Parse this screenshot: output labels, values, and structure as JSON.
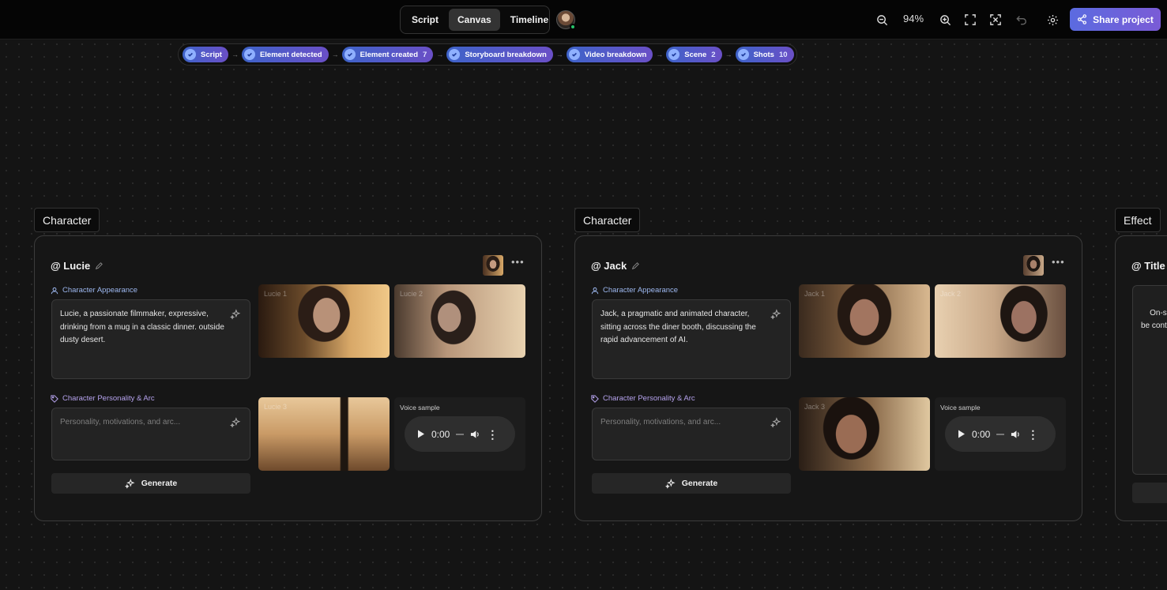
{
  "header": {
    "tabs": [
      {
        "label": "Script"
      },
      {
        "label": "Canvas"
      },
      {
        "label": "Timeline"
      }
    ],
    "zoom": "94%",
    "share_label": "Share project"
  },
  "pipeline": [
    {
      "label": "Script",
      "count": ""
    },
    {
      "label": "Element detected",
      "count": ""
    },
    {
      "label": "Element created",
      "count": "7"
    },
    {
      "label": "Storyboard breakdown",
      "count": ""
    },
    {
      "label": "Video breakdown",
      "count": ""
    },
    {
      "label": "Scene",
      "count": "2"
    },
    {
      "label": "Shots",
      "count": "10"
    }
  ],
  "cards": [
    {
      "type_label": "Character",
      "title": "@ Lucie",
      "appearance_label": "Character Appearance",
      "appearance_text": "Lucie, a passionate filmmaker, expressive, drinking from a mug in a classic dinner. outside dusty desert.",
      "personality_label": "Character Personality & Arc",
      "personality_placeholder": "Personality, motivations, and arc...",
      "generate_label": "Generate",
      "images": [
        "Lucie 1",
        "Lucie 2",
        "Lucie 3"
      ],
      "voice_label": "Voice sample",
      "voice_time": "0:00"
    },
    {
      "type_label": "Character",
      "title": "@ Jack",
      "appearance_label": "Character Appearance",
      "appearance_text": "Jack, a pragmatic and animated character, sitting across the diner booth, discussing the rapid advancement of AI.",
      "personality_label": "Character Personality & Arc",
      "personality_placeholder": "Personality, motivations, and arc...",
      "generate_label": "Generate",
      "images": [
        "Jack 1",
        "Jack 2",
        "Jack 3"
      ],
      "voice_label": "Voice sample",
      "voice_time": "0:00"
    },
    {
      "type_label": "Effect",
      "title": "@ Title T",
      "body_text": "On-scr\nbe cont"
    }
  ],
  "icons": {
    "zoom_out": "zoom-out-icon",
    "zoom_in": "zoom-in-icon",
    "fit": "fit-screen-icon",
    "fullscreen": "fullscreen-icon",
    "undo": "undo-icon",
    "settings": "gear-icon",
    "share": "share-icon"
  },
  "colors": {
    "accent_start": "#5b6be0",
    "accent_end": "#7a5bd6",
    "appearance_label": "#9db8f0",
    "personality_label": "#b6a3ee",
    "online": "#27c46b"
  }
}
